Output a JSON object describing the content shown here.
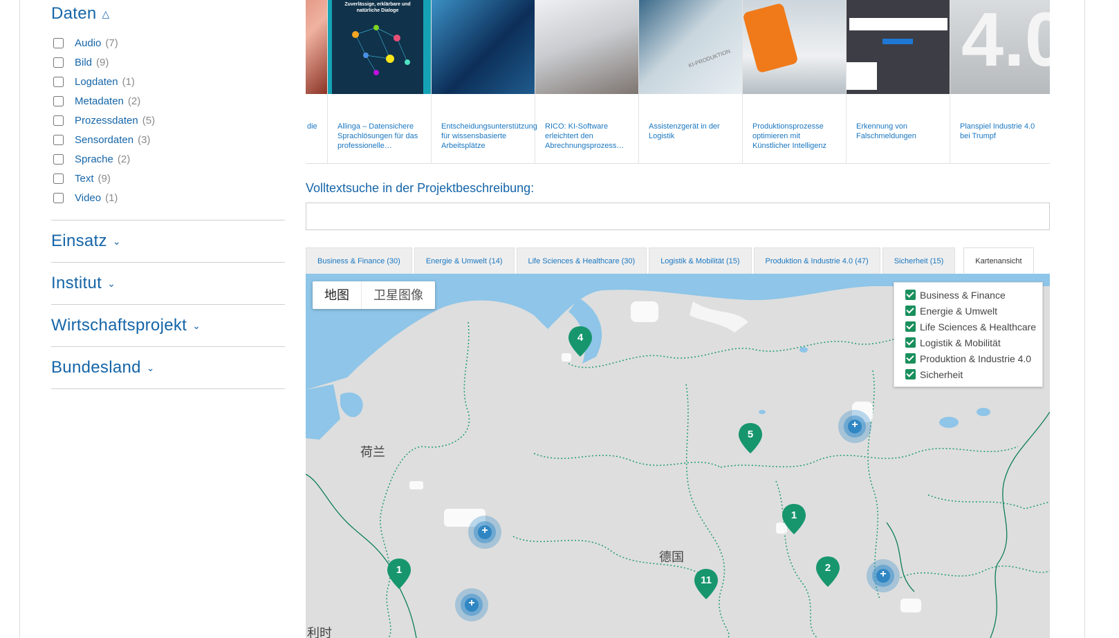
{
  "sidebar": {
    "daten": {
      "title": "Daten",
      "items": [
        {
          "label": "Audio",
          "count": "(7)"
        },
        {
          "label": "Bild",
          "count": "(9)"
        },
        {
          "label": "Logdaten",
          "count": "(1)"
        },
        {
          "label": "Metadaten",
          "count": "(2)"
        },
        {
          "label": "Prozessdaten",
          "count": "(5)"
        },
        {
          "label": "Sensordaten",
          "count": "(3)"
        },
        {
          "label": "Sprache",
          "count": "(2)"
        },
        {
          "label": "Text",
          "count": "(9)"
        },
        {
          "label": "Video",
          "count": "(1)"
        }
      ]
    },
    "einsatz": "Einsatz",
    "institut": "Institut",
    "wirtschaftsprojekt": "Wirtschaftsprojekt",
    "bundesland": "Bundesland"
  },
  "carousel": [
    {
      "caption": "die"
    },
    {
      "caption": "Allinga – Datensichere Sprachlösungen für das professionelle…",
      "thumb_text": "Zuverlässige, erklärbare und natürliche Dialoge"
    },
    {
      "caption": "Entscheidungsunterstützung für wissensbasierte Arbeitsplätze"
    },
    {
      "caption": "RICO: KI-Software erleichtert den Abrechnungsprozess…"
    },
    {
      "caption": "Assistenzgerät in der Logistik",
      "thumb_text": "KI-PRODUKTION"
    },
    {
      "caption": "Produktionsprozesse optimieren mit Künstlicher Intelligenz"
    },
    {
      "caption": "Erkennung von Falschmeldungen"
    },
    {
      "caption": "Planspiel Industrie 4.0 bei Trumpf",
      "thumb_text": "4.0"
    }
  ],
  "search": {
    "label": "Volltextsuche in der Projektbeschreibung:",
    "value": ""
  },
  "tabs": [
    "Business & Finance (30)",
    "Energie & Umwelt (14)",
    "Life Sciences & Healthcare (30)",
    "Logistik & Mobilität (15)",
    "Produktion & Industrie 4.0 (47)",
    "Sicherheit (15)",
    "Kartenansicht"
  ],
  "map": {
    "type_buttons": [
      "地图",
      "卫星图像"
    ],
    "legend": [
      "Business & Finance",
      "Energie & Umwelt",
      "Life Sciences & Healthcare",
      "Logistik & Mobilität",
      "Produktion & Industrie 4.0",
      "Sicherheit"
    ],
    "labels": {
      "netherlands": "荷兰",
      "germany": "德国",
      "belgium": "利时"
    },
    "pins": [
      "4",
      "5",
      "1",
      "1",
      "2",
      "11"
    ],
    "cluster_label": "+",
    "colors": {
      "pin": "#17966e",
      "cluster": "#2f86c3",
      "water": "#8ec5e8",
      "land": "#dedede",
      "border": "#1c9a6c"
    }
  }
}
